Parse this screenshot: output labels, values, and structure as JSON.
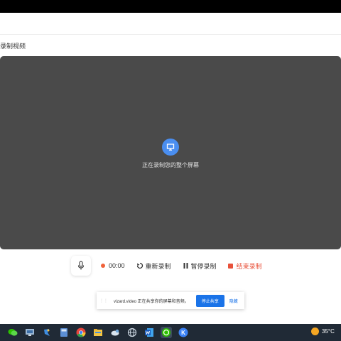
{
  "page": {
    "title": "录制视频"
  },
  "preview": {
    "status_text": "正在录制您的整个屏幕"
  },
  "controls": {
    "timer": "00:00",
    "restart_label": "重新录制",
    "pause_label": "暂停录制",
    "stop_label": "结束录制"
  },
  "share_notice": {
    "message": "vizard.video 正在共享你的屏幕和音频。",
    "stop_button": "停止共享",
    "hide_link": "隐藏"
  },
  "taskbar": {
    "apps": [
      "wechat-icon",
      "network-icon",
      "bird-app-icon",
      "calculator-icon",
      "chrome-icon",
      "file-explorer-icon",
      "bird-app-2-icon",
      "globe-icon",
      "word-icon",
      "wechat-active-icon",
      "k-app-icon"
    ],
    "temperature": "35°C"
  },
  "colors": {
    "accent": "#4a8ef0",
    "record_red": "#e8513a",
    "preview_bg": "#4a4a4a",
    "taskbar_bg": "#202a36"
  }
}
